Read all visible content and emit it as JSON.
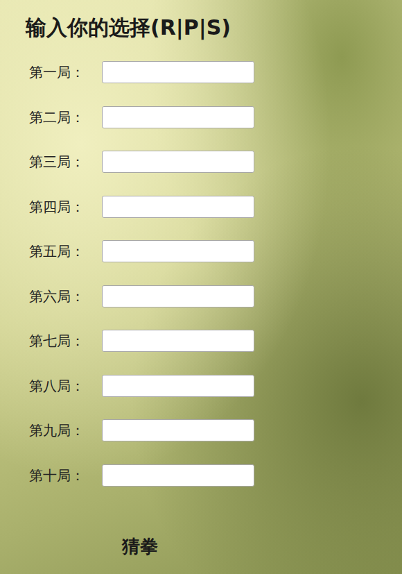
{
  "heading": "输入你的选择(R|P|S)",
  "rounds": [
    {
      "label": "第一局：",
      "value": ""
    },
    {
      "label": "第二局：",
      "value": ""
    },
    {
      "label": "第三局：",
      "value": ""
    },
    {
      "label": "第四局：",
      "value": ""
    },
    {
      "label": "第五局：",
      "value": ""
    },
    {
      "label": "第六局：",
      "value": ""
    },
    {
      "label": "第七局：",
      "value": ""
    },
    {
      "label": "第八局：",
      "value": ""
    },
    {
      "label": "第九局：",
      "value": ""
    },
    {
      "label": "第十局：",
      "value": ""
    }
  ],
  "button": "猜拳"
}
